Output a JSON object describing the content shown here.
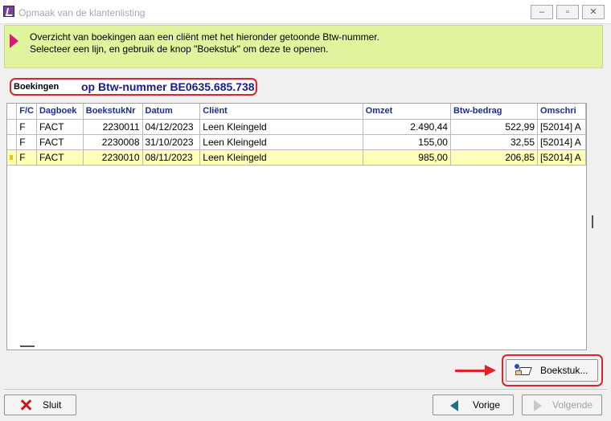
{
  "window": {
    "title": "Opmaak van de klantenlisting",
    "min_symbol": "–",
    "max_symbol": "▫",
    "close_symbol": "✕"
  },
  "banner": {
    "line1": "Overzicht van boekingen aan een cliënt met het hieronder getoonde Btw-nummer.",
    "line2": "Selecteer een lijn, en gebruik de knop \"Boekstuk\" om deze te openen."
  },
  "heading": {
    "label": "Boekingen",
    "btw": "op Btw-nummer BE0635.685.738"
  },
  "grid": {
    "columns": [
      "F/C",
      "Dagboek",
      "BoekstukNr",
      "Datum",
      "Cliënt",
      "Omzet",
      "Btw-bedrag",
      "Omschri"
    ],
    "rows": [
      {
        "fc": "F",
        "dagboek": "FACT",
        "nr": "2230011",
        "datum": "04/12/2023",
        "client": "Leen Kleingeld",
        "omzet": "2.490,44",
        "btw": "522,99",
        "oms": "[52014] A"
      },
      {
        "fc": "F",
        "dagboek": "FACT",
        "nr": "2230008",
        "datum": "31/10/2023",
        "client": "Leen Kleingeld",
        "omzet": "155,00",
        "btw": "32,55",
        "oms": "[52014] A"
      },
      {
        "fc": "F",
        "dagboek": "FACT",
        "nr": "2230010",
        "datum": "08/11/2023",
        "client": "Leen Kleingeld",
        "omzet": "985,00",
        "btw": "206,85",
        "oms": "[52014] A"
      }
    ],
    "selected_row": 2
  },
  "buttons": {
    "boekstuk": "Boekstuk...",
    "sluit": "Sluit",
    "vorige": "Vorige",
    "volgende": "Volgende"
  },
  "colors": {
    "banner": "#e0f49e",
    "highlight": "#e0222a",
    "selected_row": "#ffffb8",
    "header_text": "#1b2f8c"
  }
}
